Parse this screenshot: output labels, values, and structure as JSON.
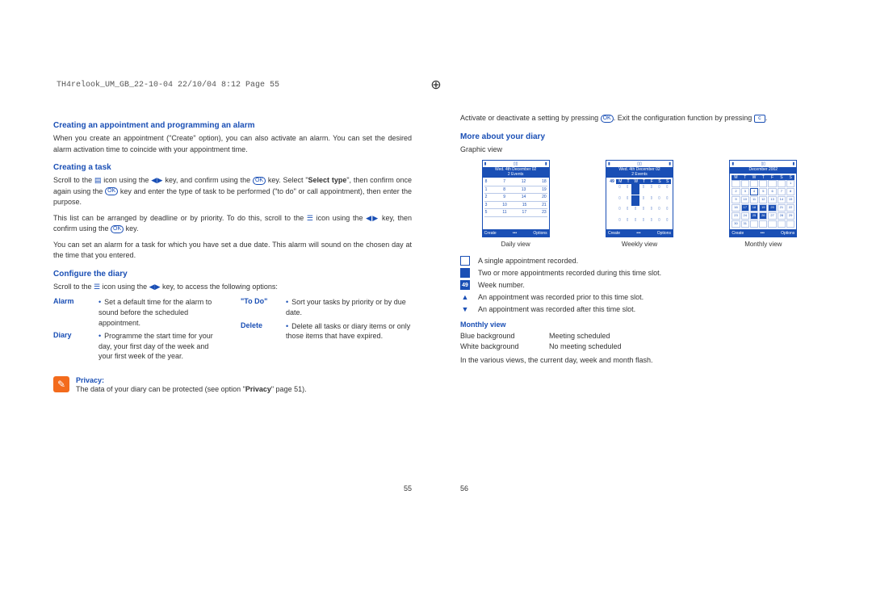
{
  "print_header": "TH4relook_UM_GB_22-10-04  22/10/04  8:12  Page 55",
  "page_numbers": {
    "left": "55",
    "right": "56"
  },
  "left": {
    "s1_title": "Creating an appointment and programming an alarm",
    "s1_body": "When you create an appointment (\"Create\" option), you can also activate an alarm. You can set the desired alarm activation time to coincide with your appointment time.",
    "s2_title": "Creating a task",
    "s2_p1a": "Scroll to the ",
    "s2_p1b": " icon using the ",
    "s2_p1c": " key, and confirm using the ",
    "s2_p1d": " key. Select \"",
    "s2_p1_bold": "Select type",
    "s2_p1e": "\", then confirm once again using the ",
    "s2_p1f": " key and enter the type of task to be performed (\"to do\" or call appointment), then enter the purpose.",
    "s2_p2a": "This list can be arranged by deadline or by priority. To do this, scroll to the ",
    "s2_p2b": " icon using the ",
    "s2_p2c": " key, then confirm using the ",
    "s2_p2d": " key.",
    "s2_p3": "You can set an alarm for a task for which you have set a due date. This alarm will sound on the chosen day at the time that you entered.",
    "s3_title": "Configure the diary",
    "s3_intro_a": "Scroll to the ",
    "s3_intro_b": " icon using the ",
    "s3_intro_c": " key, to access the following options:",
    "opts": {
      "alarm_label": "Alarm",
      "alarm_desc": "Set a default time for the alarm to sound before the scheduled appointment.",
      "diary_label": "Diary",
      "diary_desc": "Programme the start time for your day, your first day of the week and your first week of the year.",
      "todo_label": "\"To Do\"",
      "todo_desc": "Sort your tasks by priority or by due date.",
      "delete_label": "Delete",
      "delete_desc": "Delete all tasks or diary items or only those items that have expired."
    },
    "privacy_label": "Privacy:",
    "privacy_body_a": "The data of your diary can be protected (see option \"",
    "privacy_bold": "Privacy",
    "privacy_body_b": "\" page 51)."
  },
  "right": {
    "r1a": "Activate or deactivate a setting by pressing ",
    "r1b": ". Exit the configuration function by pressing ",
    "r1c": ".",
    "s1_title": "More about your diary",
    "graphic_view_label": "Graphic view",
    "view_labels": {
      "daily": "Daily view",
      "weekly": "Weekly view",
      "monthly": "Monthly view"
    },
    "screens": {
      "daily_date": "Wed. 4th December 02",
      "daily_sub": "2 Events",
      "weekly_date": "Wed. 4th December 02",
      "weekly_sub": "2 Events",
      "monthly_title": "December 2002",
      "day_head": "M T W T F S S",
      "week_num": "49",
      "foot_left": "Create",
      "foot_right": "Options",
      "daily_rows": [
        [
          "8",
          "7",
          "12",
          "18"
        ],
        [
          "1",
          "8",
          "13",
          "19"
        ],
        [
          "2",
          "9",
          "14",
          "20"
        ],
        [
          "3",
          "10",
          "15",
          "21"
        ],
        [
          "5",
          "11",
          "17",
          "23"
        ]
      ],
      "month_cells": [
        [
          "",
          "",
          "",
          "",
          "",
          "",
          "1"
        ],
        [
          "2",
          "3",
          "4",
          "5",
          "6",
          "7",
          "8"
        ],
        [
          "9",
          "10",
          "11",
          "12",
          "13",
          "14",
          "15"
        ],
        [
          "16",
          "17",
          "18",
          "19",
          "20",
          "21",
          "22"
        ],
        [
          "23",
          "24",
          "25",
          "26",
          "27",
          "28",
          "29"
        ],
        [
          "30",
          "31",
          "",
          "",
          "",
          "",
          ""
        ]
      ]
    },
    "legend": {
      "single": "A single appointment recorded.",
      "multi": "Two or more appointments recorded during this time slot.",
      "weeknum": "Week number.",
      "weeknum_val": "49",
      "before": "An appointment was recorded prior to this time slot.",
      "after": "An appointment was recorded after this time slot."
    },
    "mv_title": "Monthly view",
    "mv": {
      "blue_l": "Blue background",
      "blue_v": "Meeting scheduled",
      "white_l": "White background",
      "white_v": "No meeting scheduled"
    },
    "closing": "In the various views, the current day, week and month flash."
  }
}
